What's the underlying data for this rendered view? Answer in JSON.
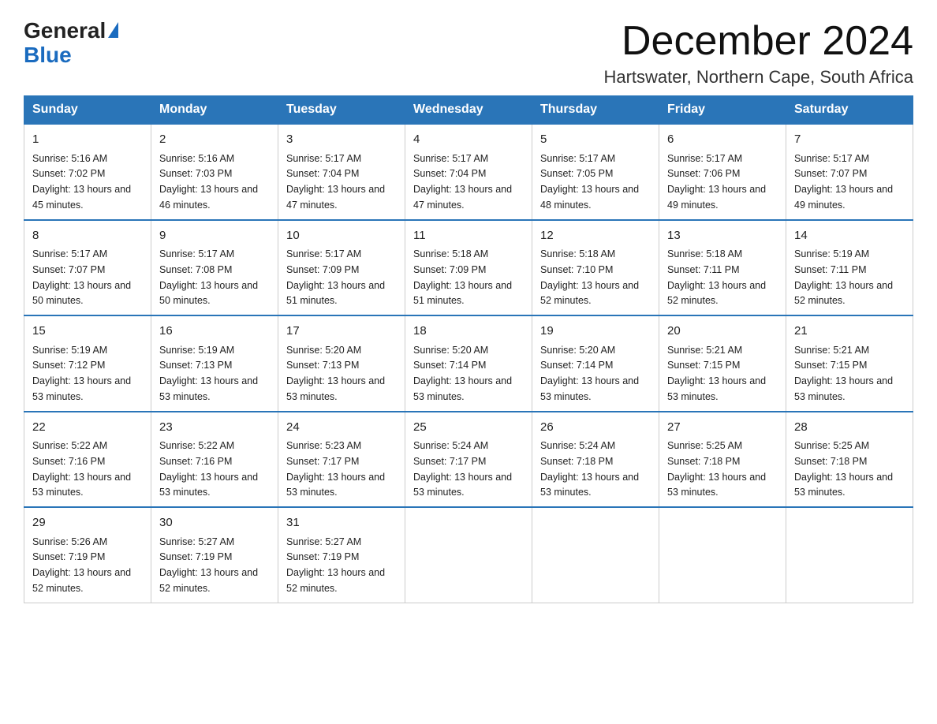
{
  "logo": {
    "general": "General",
    "triangle": "▶",
    "blue": "Blue"
  },
  "title": {
    "month": "December 2024",
    "location": "Hartswater, Northern Cape, South Africa"
  },
  "headers": [
    "Sunday",
    "Monday",
    "Tuesday",
    "Wednesday",
    "Thursday",
    "Friday",
    "Saturday"
  ],
  "weeks": [
    [
      {
        "day": "1",
        "sunrise": "Sunrise: 5:16 AM",
        "sunset": "Sunset: 7:02 PM",
        "daylight": "Daylight: 13 hours and 45 minutes."
      },
      {
        "day": "2",
        "sunrise": "Sunrise: 5:16 AM",
        "sunset": "Sunset: 7:03 PM",
        "daylight": "Daylight: 13 hours and 46 minutes."
      },
      {
        "day": "3",
        "sunrise": "Sunrise: 5:17 AM",
        "sunset": "Sunset: 7:04 PM",
        "daylight": "Daylight: 13 hours and 47 minutes."
      },
      {
        "day": "4",
        "sunrise": "Sunrise: 5:17 AM",
        "sunset": "Sunset: 7:04 PM",
        "daylight": "Daylight: 13 hours and 47 minutes."
      },
      {
        "day": "5",
        "sunrise": "Sunrise: 5:17 AM",
        "sunset": "Sunset: 7:05 PM",
        "daylight": "Daylight: 13 hours and 48 minutes."
      },
      {
        "day": "6",
        "sunrise": "Sunrise: 5:17 AM",
        "sunset": "Sunset: 7:06 PM",
        "daylight": "Daylight: 13 hours and 49 minutes."
      },
      {
        "day": "7",
        "sunrise": "Sunrise: 5:17 AM",
        "sunset": "Sunset: 7:07 PM",
        "daylight": "Daylight: 13 hours and 49 minutes."
      }
    ],
    [
      {
        "day": "8",
        "sunrise": "Sunrise: 5:17 AM",
        "sunset": "Sunset: 7:07 PM",
        "daylight": "Daylight: 13 hours and 50 minutes."
      },
      {
        "day": "9",
        "sunrise": "Sunrise: 5:17 AM",
        "sunset": "Sunset: 7:08 PM",
        "daylight": "Daylight: 13 hours and 50 minutes."
      },
      {
        "day": "10",
        "sunrise": "Sunrise: 5:17 AM",
        "sunset": "Sunset: 7:09 PM",
        "daylight": "Daylight: 13 hours and 51 minutes."
      },
      {
        "day": "11",
        "sunrise": "Sunrise: 5:18 AM",
        "sunset": "Sunset: 7:09 PM",
        "daylight": "Daylight: 13 hours and 51 minutes."
      },
      {
        "day": "12",
        "sunrise": "Sunrise: 5:18 AM",
        "sunset": "Sunset: 7:10 PM",
        "daylight": "Daylight: 13 hours and 52 minutes."
      },
      {
        "day": "13",
        "sunrise": "Sunrise: 5:18 AM",
        "sunset": "Sunset: 7:11 PM",
        "daylight": "Daylight: 13 hours and 52 minutes."
      },
      {
        "day": "14",
        "sunrise": "Sunrise: 5:19 AM",
        "sunset": "Sunset: 7:11 PM",
        "daylight": "Daylight: 13 hours and 52 minutes."
      }
    ],
    [
      {
        "day": "15",
        "sunrise": "Sunrise: 5:19 AM",
        "sunset": "Sunset: 7:12 PM",
        "daylight": "Daylight: 13 hours and 53 minutes."
      },
      {
        "day": "16",
        "sunrise": "Sunrise: 5:19 AM",
        "sunset": "Sunset: 7:13 PM",
        "daylight": "Daylight: 13 hours and 53 minutes."
      },
      {
        "day": "17",
        "sunrise": "Sunrise: 5:20 AM",
        "sunset": "Sunset: 7:13 PM",
        "daylight": "Daylight: 13 hours and 53 minutes."
      },
      {
        "day": "18",
        "sunrise": "Sunrise: 5:20 AM",
        "sunset": "Sunset: 7:14 PM",
        "daylight": "Daylight: 13 hours and 53 minutes."
      },
      {
        "day": "19",
        "sunrise": "Sunrise: 5:20 AM",
        "sunset": "Sunset: 7:14 PM",
        "daylight": "Daylight: 13 hours and 53 minutes."
      },
      {
        "day": "20",
        "sunrise": "Sunrise: 5:21 AM",
        "sunset": "Sunset: 7:15 PM",
        "daylight": "Daylight: 13 hours and 53 minutes."
      },
      {
        "day": "21",
        "sunrise": "Sunrise: 5:21 AM",
        "sunset": "Sunset: 7:15 PM",
        "daylight": "Daylight: 13 hours and 53 minutes."
      }
    ],
    [
      {
        "day": "22",
        "sunrise": "Sunrise: 5:22 AM",
        "sunset": "Sunset: 7:16 PM",
        "daylight": "Daylight: 13 hours and 53 minutes."
      },
      {
        "day": "23",
        "sunrise": "Sunrise: 5:22 AM",
        "sunset": "Sunset: 7:16 PM",
        "daylight": "Daylight: 13 hours and 53 minutes."
      },
      {
        "day": "24",
        "sunrise": "Sunrise: 5:23 AM",
        "sunset": "Sunset: 7:17 PM",
        "daylight": "Daylight: 13 hours and 53 minutes."
      },
      {
        "day": "25",
        "sunrise": "Sunrise: 5:24 AM",
        "sunset": "Sunset: 7:17 PM",
        "daylight": "Daylight: 13 hours and 53 minutes."
      },
      {
        "day": "26",
        "sunrise": "Sunrise: 5:24 AM",
        "sunset": "Sunset: 7:18 PM",
        "daylight": "Daylight: 13 hours and 53 minutes."
      },
      {
        "day": "27",
        "sunrise": "Sunrise: 5:25 AM",
        "sunset": "Sunset: 7:18 PM",
        "daylight": "Daylight: 13 hours and 53 minutes."
      },
      {
        "day": "28",
        "sunrise": "Sunrise: 5:25 AM",
        "sunset": "Sunset: 7:18 PM",
        "daylight": "Daylight: 13 hours and 53 minutes."
      }
    ],
    [
      {
        "day": "29",
        "sunrise": "Sunrise: 5:26 AM",
        "sunset": "Sunset: 7:19 PM",
        "daylight": "Daylight: 13 hours and 52 minutes."
      },
      {
        "day": "30",
        "sunrise": "Sunrise: 5:27 AM",
        "sunset": "Sunset: 7:19 PM",
        "daylight": "Daylight: 13 hours and 52 minutes."
      },
      {
        "day": "31",
        "sunrise": "Sunrise: 5:27 AM",
        "sunset": "Sunset: 7:19 PM",
        "daylight": "Daylight: 13 hours and 52 minutes."
      },
      null,
      null,
      null,
      null
    ]
  ]
}
